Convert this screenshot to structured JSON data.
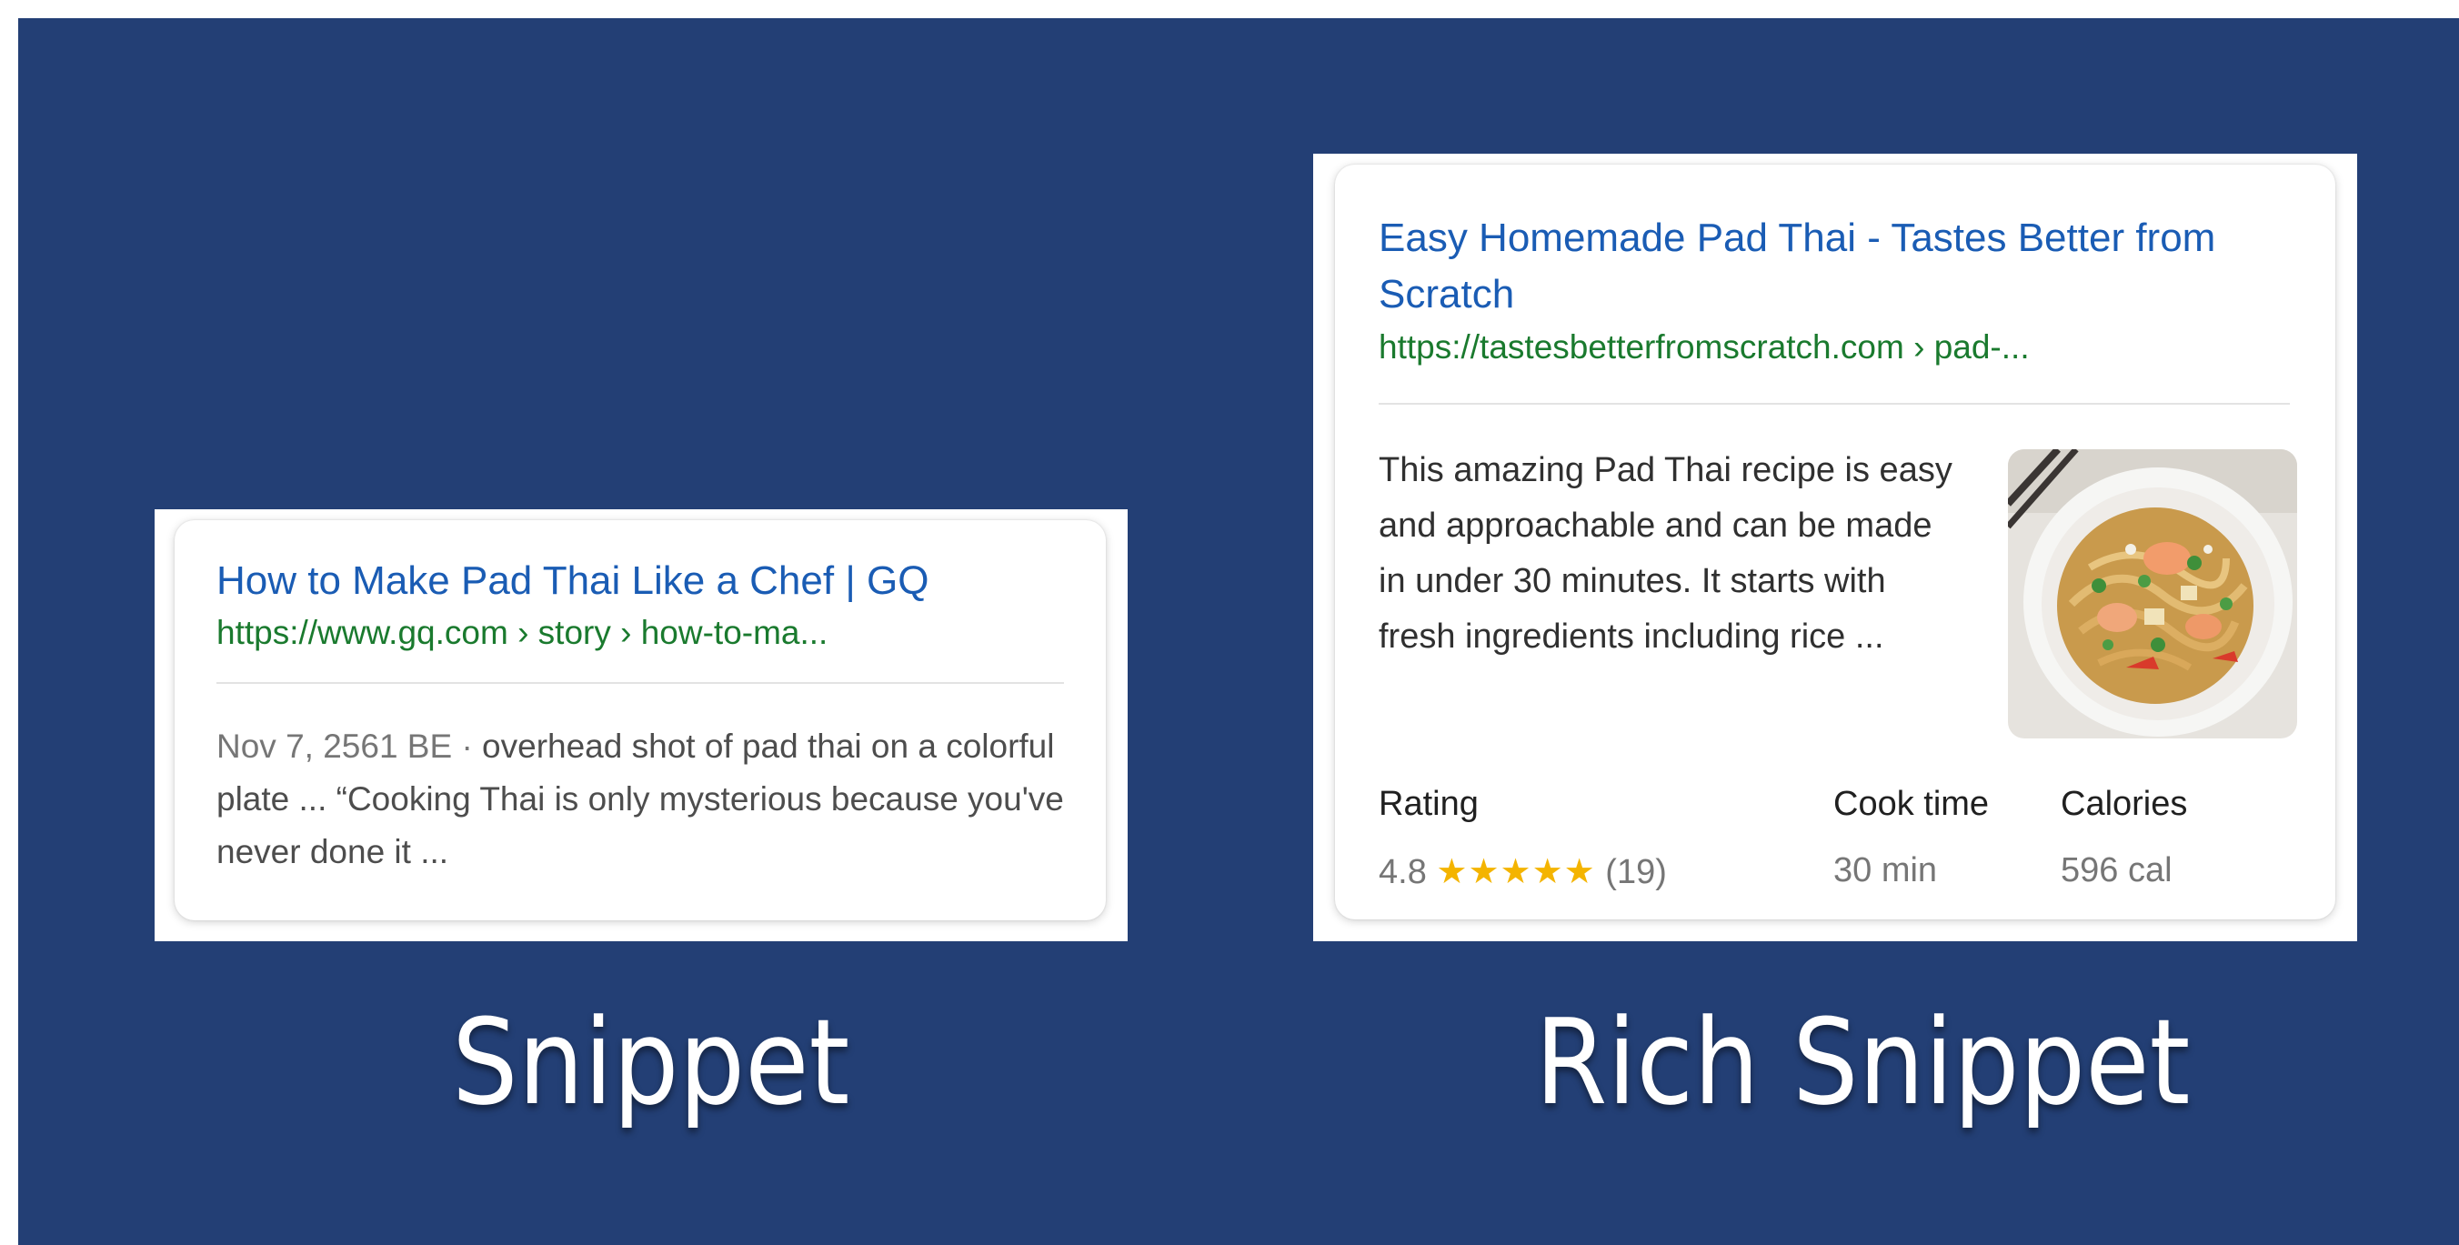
{
  "colors": {
    "background": "#233f75",
    "link_title": "#1a5cb4",
    "url_green": "#1a7a2e",
    "star_gold": "#f4b400"
  },
  "snippet": {
    "title": "How to Make Pad Thai Like a Chef | GQ",
    "url": "https://www.gq.com › story › how-to-ma...",
    "date": "Nov 7, 2561 BE · ",
    "description": "overhead shot of pad thai on a colorful plate ... “Cooking Thai is only mysterious because you've never done it ...",
    "caption": "Snippet"
  },
  "rich_snippet": {
    "title": "Easy Homemade Pad Thai - Tastes Better from Scratch",
    "url": "https://tastesbetterfromscratch.com › pad-...",
    "description": "This amazing Pad Thai recipe is easy and approachable and can be made in under 30 minutes. It starts with fresh ingredients including rice ...",
    "thumbnail_icon": "pad-thai-photo",
    "rating": {
      "label": "Rating",
      "value": "4.8",
      "stars": "★★★★★",
      "stars_count": 5,
      "reviews": "(19)"
    },
    "cook_time": {
      "label": "Cook time",
      "value": "30 min"
    },
    "calories": {
      "label": "Calories",
      "value": "596 cal"
    },
    "caption": "Rich Snippet"
  }
}
